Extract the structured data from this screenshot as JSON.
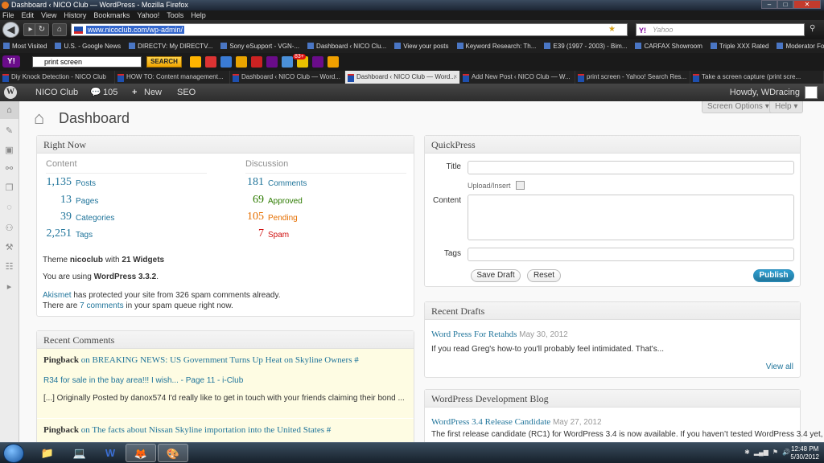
{
  "browser": {
    "title": "Dashboard ‹ NICO Club — WordPress - Mozilla Firefox",
    "menu": [
      "File",
      "Edit",
      "View",
      "History",
      "Bookmarks",
      "Yahoo!",
      "Tools",
      "Help"
    ],
    "url": "www.nicoclub.com/wp-admin/",
    "search_placeholder": "Yahoo",
    "bookmarks": [
      "Most Visited",
      "U.S. - Google News",
      "DIRECTV: My DIRECTV...",
      "Sony eSupport - VGN-...",
      "Dashboard ‹ NICO Clu...",
      "View your posts",
      "Keyword Research: Th...",
      "E39 (1997 - 2003) - Bim...",
      "CARFAX Showroom",
      "Triple XXX Rated",
      "Moderator Forum"
    ],
    "yahoo_toolbar": {
      "query": "print screen",
      "search_label": "SEARCH",
      "mail_badge": "83+"
    },
    "tabs": [
      {
        "label": "Diy Knock Detection - NICO Club",
        "active": false
      },
      {
        "label": "HOW TO: Content management...",
        "active": false
      },
      {
        "label": "Dashboard ‹ NICO Club — Word...",
        "active": false
      },
      {
        "label": "Dashboard ‹ NICO Club — Word...",
        "active": true
      },
      {
        "label": "Add New Post ‹ NICO Club — W...",
        "active": false
      },
      {
        "label": "print screen - Yahoo! Search Res...",
        "active": false
      },
      {
        "label": "Take a screen capture (print scre...",
        "active": false
      }
    ]
  },
  "adminbar": {
    "site": "NICO Club",
    "comments": "105",
    "new": "New",
    "seo": "SEO",
    "howdy": "Howdy, WDracing"
  },
  "page": {
    "title": "Dashboard",
    "screen_options": "Screen Options",
    "help": "Help"
  },
  "right_now": {
    "title": "Right Now",
    "content_head": "Content",
    "discussion_head": "Discussion",
    "content": [
      {
        "count": "1,135",
        "label": "Posts"
      },
      {
        "count": "13",
        "label": "Pages"
      },
      {
        "count": "39",
        "label": "Categories"
      },
      {
        "count": "2,251",
        "label": "Tags"
      }
    ],
    "discussion": [
      {
        "count": "181",
        "label": "Comments"
      },
      {
        "count": "69",
        "label": "Approved"
      },
      {
        "count": "105",
        "label": "Pending"
      },
      {
        "count": "7",
        "label": "Spam"
      }
    ],
    "theme_pre": "Theme",
    "theme_name": "nicoclub",
    "theme_mid": "with",
    "widgets": "21 Widgets",
    "version_pre": "You are using",
    "version": "WordPress 3.3.2",
    "akismet_link": "Akismet",
    "akismet_text": "has protected your site from 326 spam comments already.",
    "queue_pre": "There are",
    "queue_link": "7 comments",
    "queue_post": "in your spam queue right now."
  },
  "recent_comments": {
    "title": "Recent Comments",
    "items": [
      {
        "kind": "Pingback",
        "on": "on",
        "post": "BREAKING NEWS: US Government Turns Up Heat on Skyline Owners #",
        "source": "R34 for sale in the bay area!!! I wish... - Page 11 - i-Club",
        "excerpt": "[...] Originally Posted by danox574 I'd really like to get in touch with your friends claiming their bond ..."
      },
      {
        "kind": "Pingback",
        "on": "on",
        "post": "The facts about Nissan Skyline importation into the United States #"
      }
    ]
  },
  "quickpress": {
    "title": "QuickPress",
    "title_label": "Title",
    "upload_label": "Upload/Insert",
    "content_label": "Content",
    "tags_label": "Tags",
    "save_draft": "Save Draft",
    "reset": "Reset",
    "publish": "Publish"
  },
  "recent_drafts": {
    "title": "Recent Drafts",
    "draft_title": "Word Press For Retahds",
    "draft_date": "May 30, 2012",
    "draft_excerpt": "If you read Greg's how-to you'll probably feel intimidated. That's...",
    "view_all": "View all"
  },
  "dev_blog": {
    "title": "WordPress Development Blog",
    "post_title": "WordPress 3.4 Release Candidate",
    "post_date": "May 27, 2012",
    "excerpt": "The first release candidate (RC1) for WordPress 3.4 is now available. If you haven’t tested WordPress 3.4 yet,"
  },
  "taskbar": {
    "time": "12:48 PM",
    "date": "5/30/2012"
  }
}
